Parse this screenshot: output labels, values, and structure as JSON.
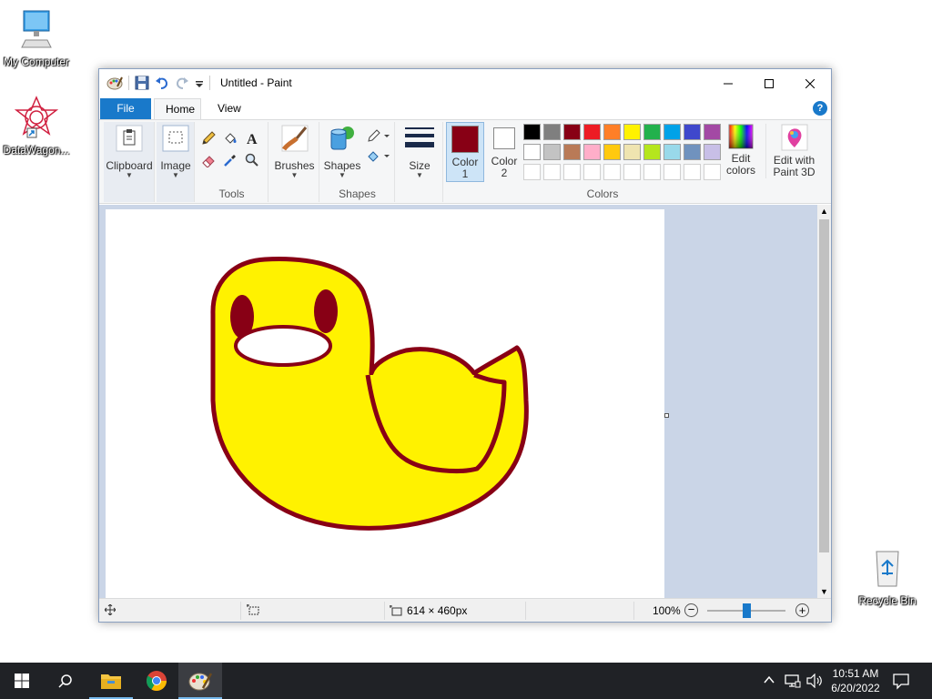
{
  "desktop": {
    "icons": [
      {
        "label": "My Computer"
      },
      {
        "label": "DataWagon..."
      },
      {
        "label": "Recycle Bin"
      }
    ]
  },
  "window": {
    "title": "Untitled - Paint",
    "tabs": {
      "file": "File",
      "home": "Home",
      "view": "View"
    },
    "help": "?"
  },
  "ribbon": {
    "clipboard": "Clipboard",
    "image": "Image",
    "tools_group": "Tools",
    "brushes": "Brushes",
    "shapes": "Shapes",
    "shapes_group": "Shapes",
    "size": "Size",
    "color1_line1": "Color",
    "color1_line2": "1",
    "color2_line1": "Color",
    "color2_line2": "2",
    "edit_colors_line1": "Edit",
    "edit_colors_line2": "colors",
    "paint3d_line1": "Edit with",
    "paint3d_line2": "Paint 3D",
    "colors_group": "Colors",
    "color1_value": "#880015",
    "color2_value": "#ffffff",
    "palette_row1": [
      "#000000",
      "#7f7f7f",
      "#880015",
      "#ed1c24",
      "#ff7f27",
      "#fff200",
      "#22b14c",
      "#00a2e8",
      "#3f48cc",
      "#a349a4"
    ],
    "palette_row2": [
      "#ffffff",
      "#c3c3c3",
      "#b97a57",
      "#ffaec9",
      "#ffc90e",
      "#efe4b0",
      "#b5e61d",
      "#99d9ea",
      "#7092be",
      "#c8bfe7"
    ]
  },
  "status": {
    "dimensions": "614 × 460px",
    "zoom": "100%",
    "zoom_level": 0.5
  },
  "taskbar": {
    "time": "10:51 AM",
    "date": "6/20/2022"
  }
}
